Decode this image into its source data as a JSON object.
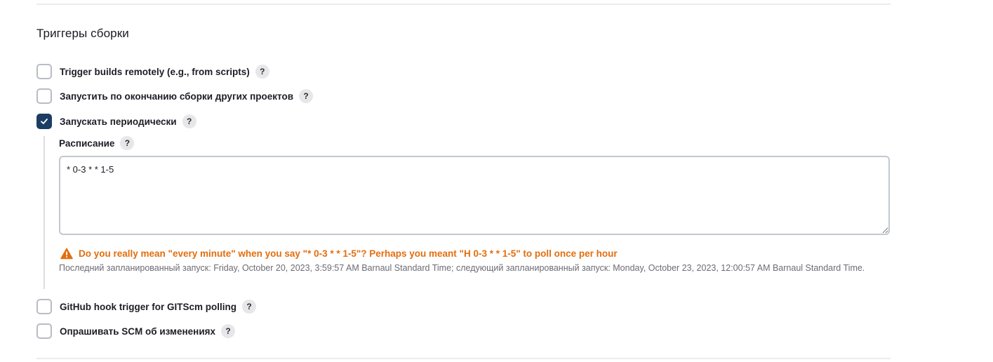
{
  "section": {
    "title": "Триггеры сборки"
  },
  "options": [
    {
      "label": "Trigger builds remotely (e.g., from scripts)",
      "checked": false
    },
    {
      "label": "Запустить по окончанию сборки других проектов",
      "checked": false
    },
    {
      "label": "Запускать периодически",
      "checked": true
    },
    {
      "label": "GitHub hook trigger for GITScm polling",
      "checked": false
    },
    {
      "label": "Опрашивать SCM об изменениях",
      "checked": false
    }
  ],
  "help_glyph": "?",
  "schedule": {
    "label": "Расписание",
    "value": "* 0-3 * * 1-5",
    "warning": "Do you really mean \"every minute\" when you say \"* 0-3 * * 1-5\"? Perhaps you meant \"H 0-3 * * 1-5\" to poll once per hour",
    "info": "Последний запланированный запуск: Friday, October 20, 2023, 3:59:57 AM Barnaul Standard Time; следующий запланированный запуск: Monday, October 23, 2023, 12:00:57 AM Barnaul Standard Time."
  },
  "colors": {
    "checkbox_checked": "#1c3d63",
    "warning": "#e26e0e",
    "info_text": "#6b6b75"
  },
  "icons": {
    "check": "check-icon",
    "warning": "warning-triangle-icon",
    "help": "help-icon"
  }
}
